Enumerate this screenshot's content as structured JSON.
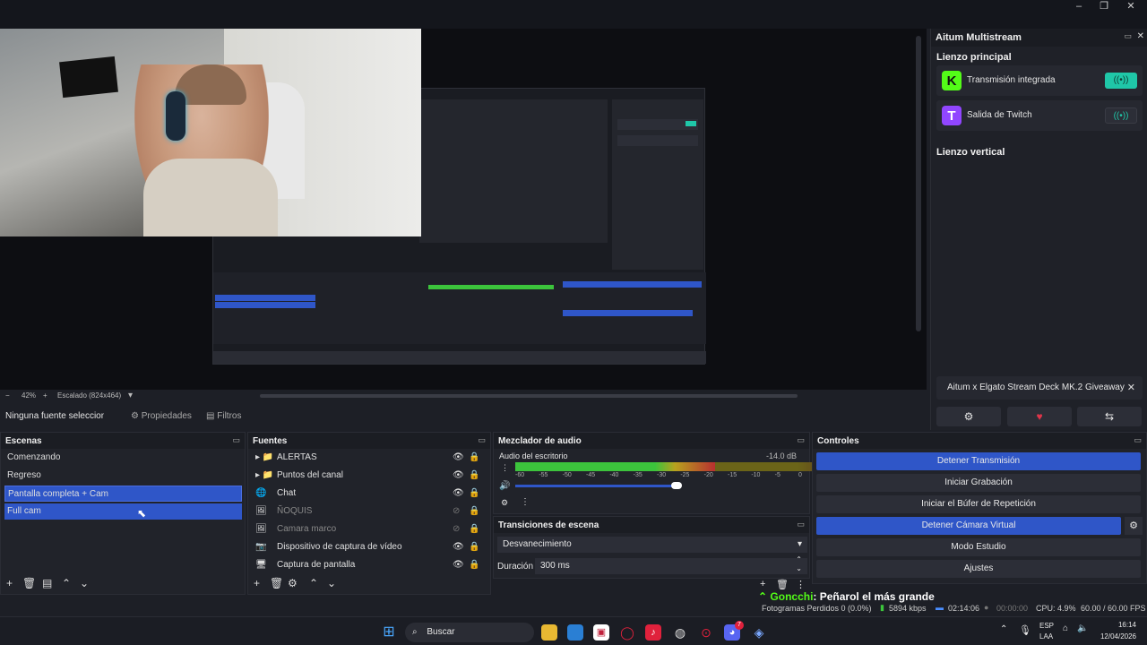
{
  "window": {
    "minimize": "–",
    "maximize": "❐",
    "close": "✕"
  },
  "multistream": {
    "title": "Aitum Multistream",
    "section_main": "Lienzo principal",
    "section_vertical": "Lienzo vertical",
    "outputs": [
      {
        "label": "Transmisión integrada",
        "logo": "K",
        "logo_color": "#53fc18",
        "active": true
      },
      {
        "label": "Salida de Twitch",
        "logo": "T",
        "logo_color": "#9146ff",
        "active": false
      }
    ],
    "promo": "Aitum x Elgato Stream Deck MK.2 Giveaway",
    "promo_close": "✕",
    "btn_settings": "⚙",
    "btn_heart": "♥",
    "btn_link": "⇆"
  },
  "zoom": {
    "minus": "−",
    "value": "42%",
    "plus": "+",
    "scale_label": "Escalado (824x464)",
    "dropdown": "▾"
  },
  "source_toolbar": {
    "no_source": "Ninguna fuente seleccionada",
    "properties": "Propiedades",
    "filters": "Filtros"
  },
  "scenes": {
    "title": "Escenas",
    "items": [
      "Comenzando",
      "Regreso",
      "Pantalla completa + Cam",
      "Full cam"
    ],
    "selected_index": 3
  },
  "sources": {
    "title": "Fuentes",
    "items": [
      {
        "label": "ALERTAS",
        "icon": "📁",
        "group": true,
        "visible": true
      },
      {
        "label": "Puntos del  canal",
        "icon": "📁",
        "group": true,
        "visible": true
      },
      {
        "label": "Chat",
        "icon": "🌐",
        "group": false,
        "visible": true
      },
      {
        "label": "ÑOQUIS",
        "icon": "🖼",
        "group": false,
        "visible": false
      },
      {
        "label": "Camara marco",
        "icon": "🖼",
        "group": false,
        "visible": false
      },
      {
        "label": "Dispositivo de captura de vídeo",
        "icon": "📷",
        "group": false,
        "visible": true
      },
      {
        "label": "Captura de pantalla",
        "icon": "🖥",
        "group": false,
        "visible": true
      }
    ]
  },
  "mixer": {
    "title": "Mezclador de audio",
    "channel": "Audio del escritorio",
    "db": "-14.0 dB",
    "ticks": [
      "-60",
      "-55",
      "-50",
      "-45",
      "-40",
      "-35",
      "-30",
      "-25",
      "-20",
      "-15",
      "-10",
      "-5",
      "0"
    ],
    "level_fraction": 0.7
  },
  "transitions": {
    "title": "Transiciones de escena",
    "type": "Desvanecimiento",
    "duration_label": "Duración",
    "duration_value": "300 ms"
  },
  "controls": {
    "title": "Controles",
    "buttons": [
      {
        "label": "Detener Transmisión",
        "active": true
      },
      {
        "label": "Iniciar Grabación",
        "active": false
      },
      {
        "label": "Iniciar el Búfer de Repetición",
        "active": false
      },
      {
        "label": "Detener Cámara Virtual",
        "active": true
      },
      {
        "label": "Modo Estudio",
        "active": false
      },
      {
        "label": "Ajustes",
        "active": false
      }
    ]
  },
  "overlay": {
    "user": "Goncchi",
    "message": ": Peñarol el más grande"
  },
  "status": {
    "dropped": "Fotogramas Perdidos 0 (0.0%)",
    "bitrate": "5894 kbps",
    "live_time": "02:14:06",
    "rec_time": "00:00:00",
    "cpu": "CPU: 4.9%",
    "fps": "60.00 / 60.00 FPS"
  },
  "taskbar": {
    "search": "Buscar",
    "lang_top": "ESP",
    "lang_bottom": "LAA",
    "time": "16:14",
    "date": "12/04/2026",
    "discord_badge": "7"
  },
  "colors": {
    "accent": "#2f56c8",
    "kick": "#53fc18",
    "twitch": "#9146ff",
    "meter_green": "#3cc43c",
    "meter_yellow": "#b8a21e",
    "meter_red": "#b83030"
  }
}
